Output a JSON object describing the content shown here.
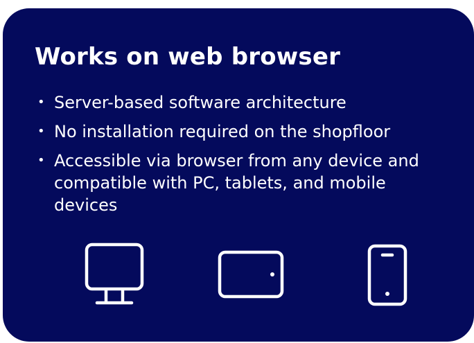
{
  "card": {
    "background_color": "#040a5c",
    "text_color": "#ffffff",
    "title": "Works on web browser",
    "bullets": [
      "Server-based software architecture",
      "No installation required on the shopfloor",
      "Accessible via browser from any device and compatible with PC, tablets, and mobile devices"
    ],
    "bullet_symbol": "•",
    "icons": [
      "desktop-monitor-icon",
      "tablet-icon",
      "mobile-phone-icon"
    ]
  }
}
